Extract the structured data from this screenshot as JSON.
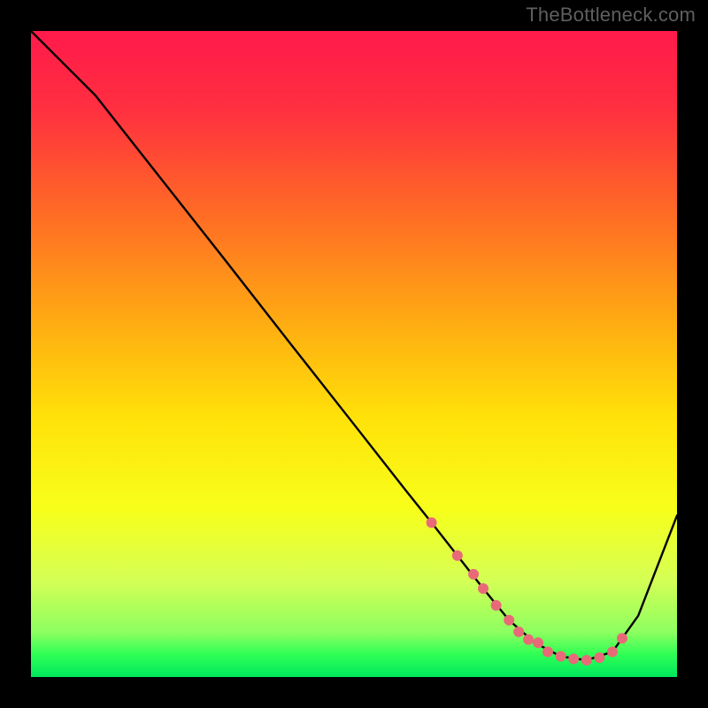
{
  "watermark": "TheBottleneck.com",
  "chart_data": {
    "type": "line",
    "title": "",
    "xlabel": "",
    "ylabel": "",
    "xlim": [
      0,
      100
    ],
    "ylim": [
      0,
      100
    ],
    "grid": false,
    "legend": false,
    "gradient_stops": [
      {
        "offset": 0.0,
        "color": "#ff1a4b"
      },
      {
        "offset": 0.12,
        "color": "#ff2f40"
      },
      {
        "offset": 0.28,
        "color": "#ff6a25"
      },
      {
        "offset": 0.45,
        "color": "#ffab12"
      },
      {
        "offset": 0.6,
        "color": "#ffe209"
      },
      {
        "offset": 0.74,
        "color": "#f7ff1a"
      },
      {
        "offset": 0.85,
        "color": "#d5ff55"
      },
      {
        "offset": 0.93,
        "color": "#8eff60"
      },
      {
        "offset": 0.965,
        "color": "#2fff55"
      },
      {
        "offset": 1.0,
        "color": "#00e85e"
      }
    ],
    "curve": {
      "x": [
        0,
        6,
        10,
        20,
        30,
        40,
        50,
        58,
        62,
        66,
        70,
        74,
        78,
        82,
        86,
        90,
        94,
        100
      ],
      "y": [
        100,
        94,
        90,
        77.3,
        64.6,
        51.8,
        39.1,
        28.9,
        23.9,
        18.8,
        13.7,
        8.8,
        5.3,
        3.2,
        2.6,
        3.9,
        9.5,
        25.0
      ]
    },
    "markers": {
      "x": [
        62,
        66,
        68.5,
        70,
        72,
        74,
        75.5,
        77,
        78.5,
        80,
        82,
        84,
        86,
        88,
        90,
        91.5
      ],
      "y": [
        23.9,
        18.8,
        15.9,
        13.7,
        11.1,
        8.8,
        7.0,
        5.8,
        5.3,
        3.9,
        3.2,
        2.8,
        2.6,
        3.0,
        3.9,
        6.0
      ],
      "color": "#e86a78",
      "radius": 6
    }
  }
}
